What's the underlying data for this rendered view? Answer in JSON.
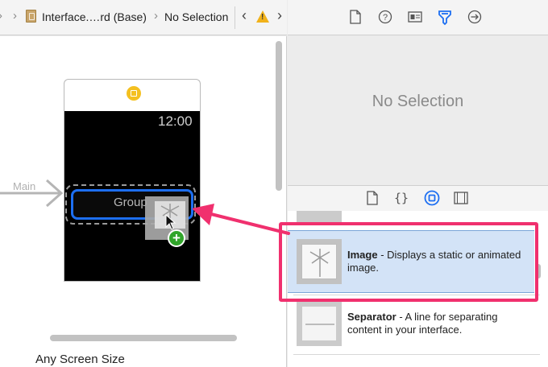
{
  "jumpbar": {
    "file_label": "Interface.…rd (Base)",
    "selection_label": "No Selection"
  },
  "canvas": {
    "entry_label": "Main",
    "clock_text": "12:00",
    "group_label": "Group",
    "size_class_label": "Any Screen Size"
  },
  "inspector": {
    "empty_state": "No Selection",
    "tabs": [
      "file-inspector",
      "quick-help",
      "identity-inspector",
      "attributes-inspector",
      "connections-inspector"
    ],
    "selected_tab": "attributes-inspector"
  },
  "library": {
    "tabs": [
      "file-template-library",
      "code-snippet-library",
      "object-library",
      "media-library"
    ],
    "selected_tab": "object-library",
    "items": [
      {
        "name": "Image",
        "description": " - Displays a static or animated image.",
        "selected": true
      },
      {
        "name": "Separator",
        "description": " - A line for separating content in your interface.",
        "selected": false
      }
    ]
  },
  "colors": {
    "accent": "#1d6ff2",
    "callout": "#f0306e",
    "add_badge": "#31a52a",
    "warning": "#f1b21a"
  }
}
